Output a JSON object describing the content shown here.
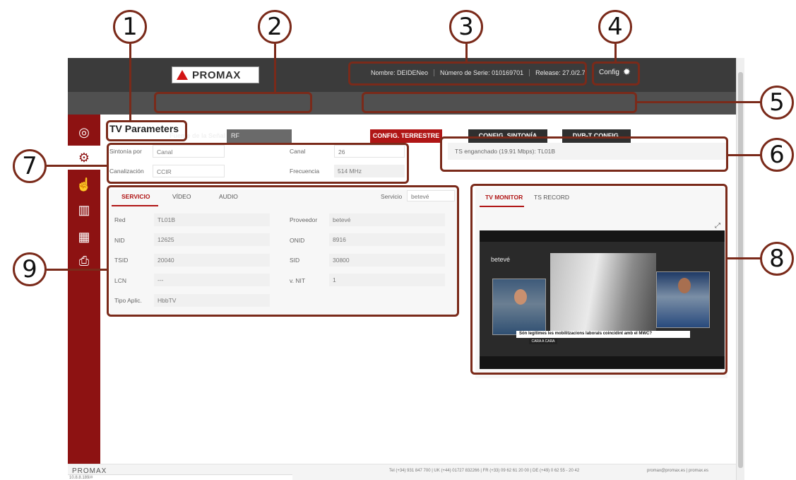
{
  "callouts": [
    "1",
    "2",
    "3",
    "4",
    "5",
    "6",
    "7",
    "8",
    "9"
  ],
  "header": {
    "logo_text": "PROMAX",
    "device_name": "Nombre: DEIDENeo",
    "serial": "Número de Serie: 010169701",
    "release": "Release: 27.0/2.7",
    "config_label": "Config"
  },
  "signal_source": {
    "label": "Fuente de la Señal",
    "value": "RF"
  },
  "config_buttons": [
    {
      "label": "CONFIG. TERRESTRE",
      "active": true
    },
    {
      "label": "CONFIG. SINTONÍA",
      "active": false
    },
    {
      "label": "DVB-T CONFIG.",
      "active": false
    }
  ],
  "page_title": "TV Parameters",
  "tuning": {
    "sintonia_label": "Sintonía por",
    "sintonia_value": "Canal",
    "canal_label": "Canal",
    "canal_value": "26",
    "canalizacion_label": "Canalización",
    "canalizacion_value": "CCIR",
    "frecuencia_label": "Frecuencia",
    "frecuencia_value": "514 MHz"
  },
  "ts_status": "TS enganchado (19.91 Mbps): TL01B",
  "service_tabs": [
    "SERVICIO",
    "VÍDEO",
    "AUDIO"
  ],
  "service_selector": {
    "label": "Servicio",
    "value": "betevé"
  },
  "service_fields": {
    "red_label": "Red",
    "red_value": "TL01B",
    "proveedor_label": "Proveedor",
    "proveedor_value": "betevé",
    "nid_label": "NID",
    "nid_value": "12625",
    "onid_label": "ONID",
    "onid_value": "8916",
    "tsid_label": "TSID",
    "tsid_value": "20040",
    "sid_label": "SID",
    "sid_value": "30800",
    "lcn_label": "LCN",
    "lcn_value": "---",
    "vnit_label": "v. NIT",
    "vnit_value": "1",
    "tipo_label": "Tipo Aplic.",
    "tipo_value": "HbbTV"
  },
  "monitor_tabs": [
    "TV MONITOR",
    "TS RECORD"
  ],
  "monitor": {
    "channel_brand": "betevé",
    "caption": "Són legítimes les mobilitzacions laborals coincidint amb el MWC?",
    "caption_tag": "CARA A CARA"
  },
  "footer": {
    "logo": "PROMAX",
    "contacts": "Tel (+34) 931 847 700   |   UK (+44) 01727 832266   |   FR (+33) 09 62 61 20 00   |   DE (+49) 0 62 55 - 20 42",
    "links": "promax@promax.es   |   promax.es",
    "ip": "10.8.8.189/#"
  },
  "colors": {
    "accent": "#b01515",
    "sidebar": "#8d1212",
    "topbar": "#3b3b3b",
    "callout": "#7a2a1a"
  }
}
